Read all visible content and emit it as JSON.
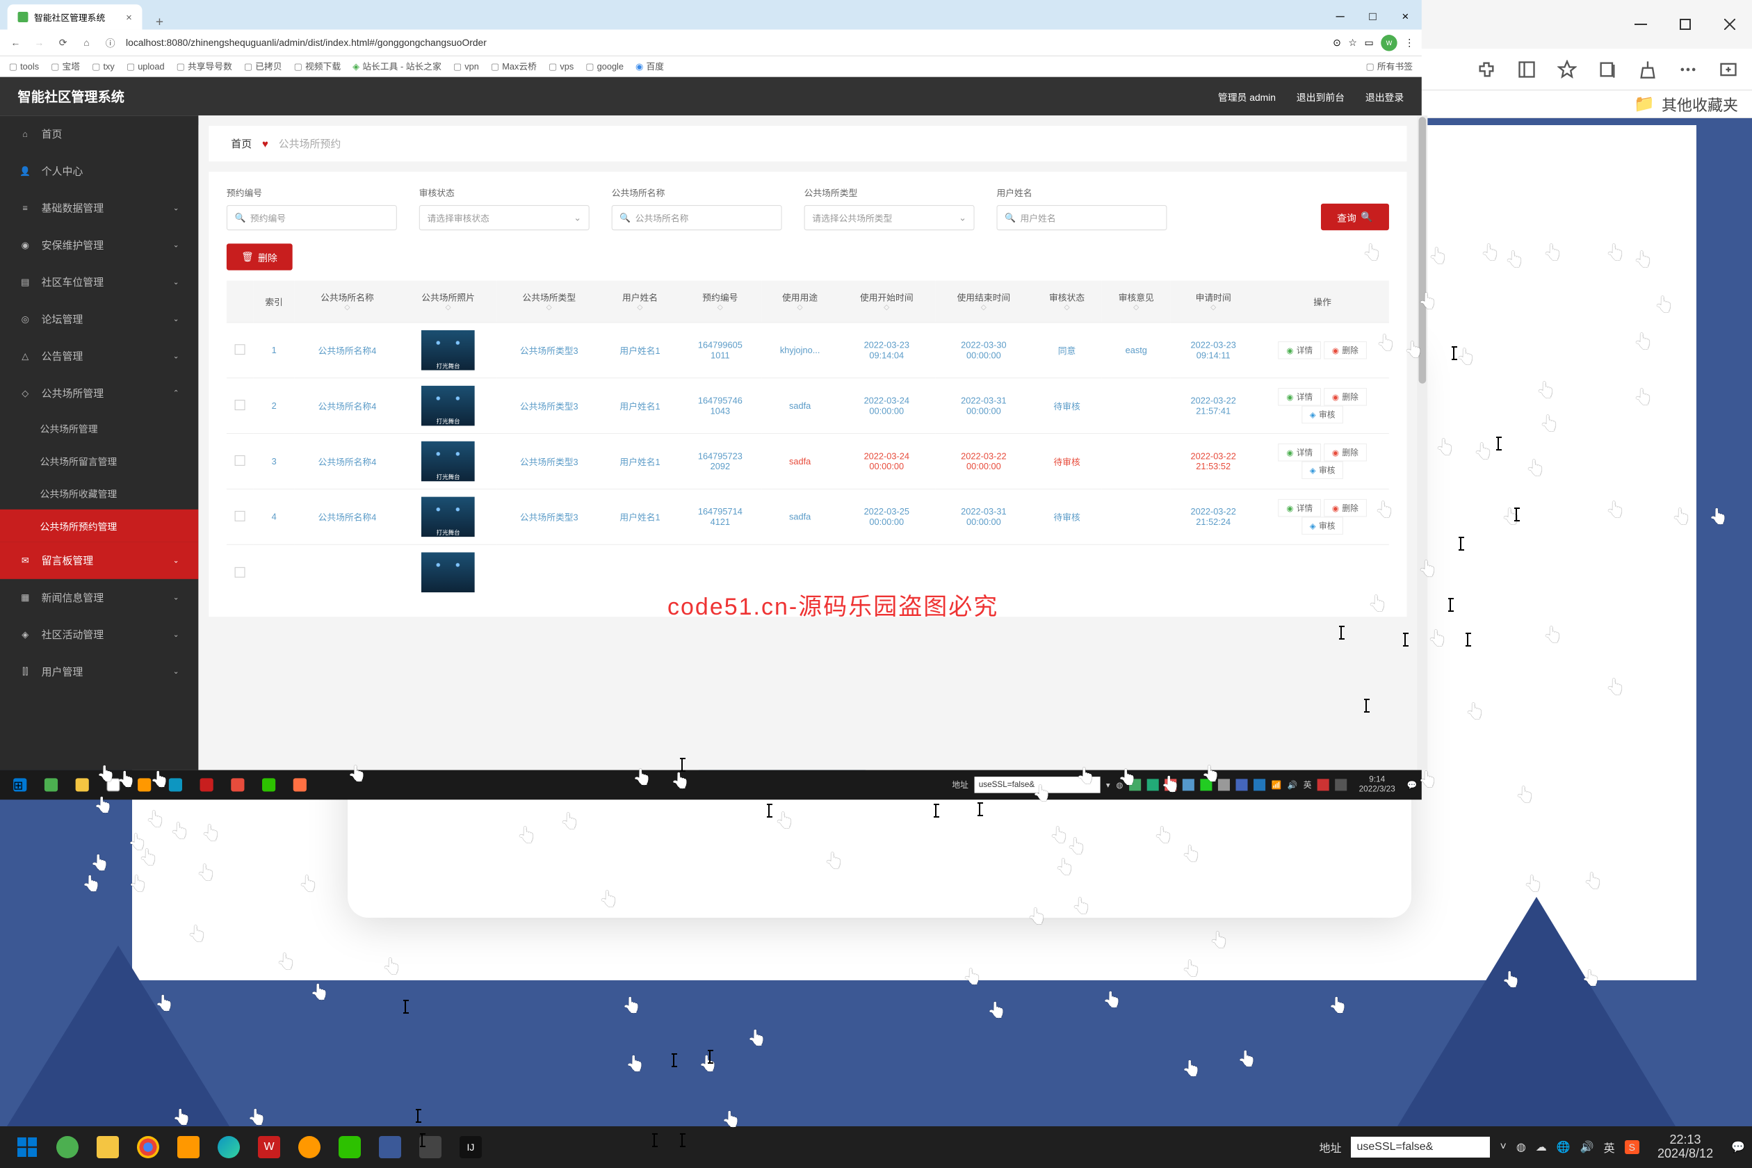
{
  "outer": {
    "favorites_label": "其他收藏夹",
    "taskbar_addr_label": "地址",
    "taskbar_addr_value": "useSSL=false&",
    "clock_time": "22:13",
    "clock_date": "2024/8/12",
    "tray_ime": "英"
  },
  "inner_browser": {
    "tab_title": "智能社区管理系统",
    "url": "localhost:8080/zhinengshequguanli/admin/dist/index.html#/gonggongchangsuoOrder",
    "bookmarks": [
      "tools",
      "宝塔",
      "txy",
      "upload",
      "共享导号数",
      "已拷贝",
      "视频下载",
      "站长工具 - 站长之家",
      "vpn",
      "Max云桥",
      "vps",
      "google",
      "百度"
    ],
    "bookmarks_right": "所有书签"
  },
  "app": {
    "title": "智能社区管理系统",
    "header_user": "管理员 admin",
    "header_exit_back": "退出到前台",
    "header_logout": "退出登录"
  },
  "sidebar": {
    "items": [
      {
        "icon": "home",
        "label": "首页"
      },
      {
        "icon": "user",
        "label": "个人中心"
      },
      {
        "icon": "db",
        "label": "基础数据管理",
        "expand": true
      },
      {
        "icon": "shield",
        "label": "安保维护管理",
        "expand": true
      },
      {
        "icon": "car",
        "label": "社区车位管理",
        "expand": true
      },
      {
        "icon": "forum",
        "label": "论坛管理",
        "expand": true
      },
      {
        "icon": "bell",
        "label": "公告管理",
        "expand": true
      },
      {
        "icon": "place",
        "label": "公共场所管理",
        "expand": true,
        "open": true
      },
      {
        "icon": "msg",
        "label": "留言板管理",
        "hl": true,
        "expand": true
      },
      {
        "icon": "news",
        "label": "新闻信息管理",
        "expand": true
      },
      {
        "icon": "act",
        "label": "社区活动管理",
        "expand": true
      },
      {
        "icon": "users",
        "label": "用户管理",
        "expand": true
      }
    ],
    "subs": [
      "公共场所管理",
      "公共场所留言管理",
      "公共场所收藏管理",
      "公共场所预约管理"
    ]
  },
  "breadcrumb": {
    "home": "首页",
    "current": "公共场所预约"
  },
  "filters": {
    "f1_label": "预约编号",
    "f1_ph": "预约编号",
    "f2_label": "审核状态",
    "f2_ph": "请选择审核状态",
    "f3_label": "公共场所名称",
    "f3_ph": "公共场所名称",
    "f4_label": "公共场所类型",
    "f4_ph": "请选择公共场所类型",
    "f5_label": "用户姓名",
    "f5_ph": "用户姓名",
    "search": "查询",
    "delete": "删除"
  },
  "table": {
    "headers": [
      "",
      "索引",
      "公共场所名称",
      "公共场所照片",
      "公共场所类型",
      "用户姓名",
      "预约编号",
      "使用用途",
      "使用开始时间",
      "使用结束时间",
      "审核状态",
      "审核意见",
      "申请时间",
      "操作"
    ],
    "action_detail": "详情",
    "action_delete": "删除",
    "action_audit": "审核",
    "rows": [
      {
        "idx": "1",
        "name": "公共场所名称4",
        "type": "公共场所类型3",
        "user": "用户姓名1",
        "code": "164799605\n1011",
        "purpose": "khyjojno...",
        "start": "2022-03-23\n09:14:04",
        "end": "2022-03-30\n00:00:00",
        "status": "同意",
        "opinion": "eastg",
        "apply": "2022-03-23\n09:14:11",
        "actions": 2
      },
      {
        "idx": "2",
        "name": "公共场所名称4",
        "type": "公共场所类型3",
        "user": "用户姓名1",
        "code": "164795746\n1043",
        "purpose": "sadfa",
        "start": "2022-03-24\n00:00:00",
        "end": "2022-03-31\n00:00:00",
        "status": "待审核",
        "opinion": "",
        "apply": "2022-03-22\n21:57:41",
        "actions": 3
      },
      {
        "idx": "3",
        "name": "公共场所名称4",
        "type": "公共场所类型3",
        "user": "用户姓名1",
        "code": "164795723\n2092",
        "purpose": "sadfa",
        "start": "2022-03-24\n00:00:00",
        "end": "2022-03-22\n00:00:00",
        "status": "待审核",
        "opinion": "",
        "apply": "2022-03-22\n21:53:52",
        "actions": 3
      },
      {
        "idx": "4",
        "name": "公共场所名称4",
        "type": "公共场所类型3",
        "user": "用户姓名1",
        "code": "164795714\n4121",
        "purpose": "sadfa",
        "start": "2022-03-25\n00:00:00",
        "end": "2022-03-31\n00:00:00",
        "status": "待审核",
        "opinion": "",
        "apply": "2022-03-22\n21:52:24",
        "actions": 3
      }
    ]
  },
  "watermark": "code51.cn-源码乐园盗图必究",
  "inner_taskbar": {
    "addr_label": "地址",
    "addr_value": "useSSL=false&",
    "clock_time": "9:14",
    "clock_date": "2022/3/23"
  }
}
